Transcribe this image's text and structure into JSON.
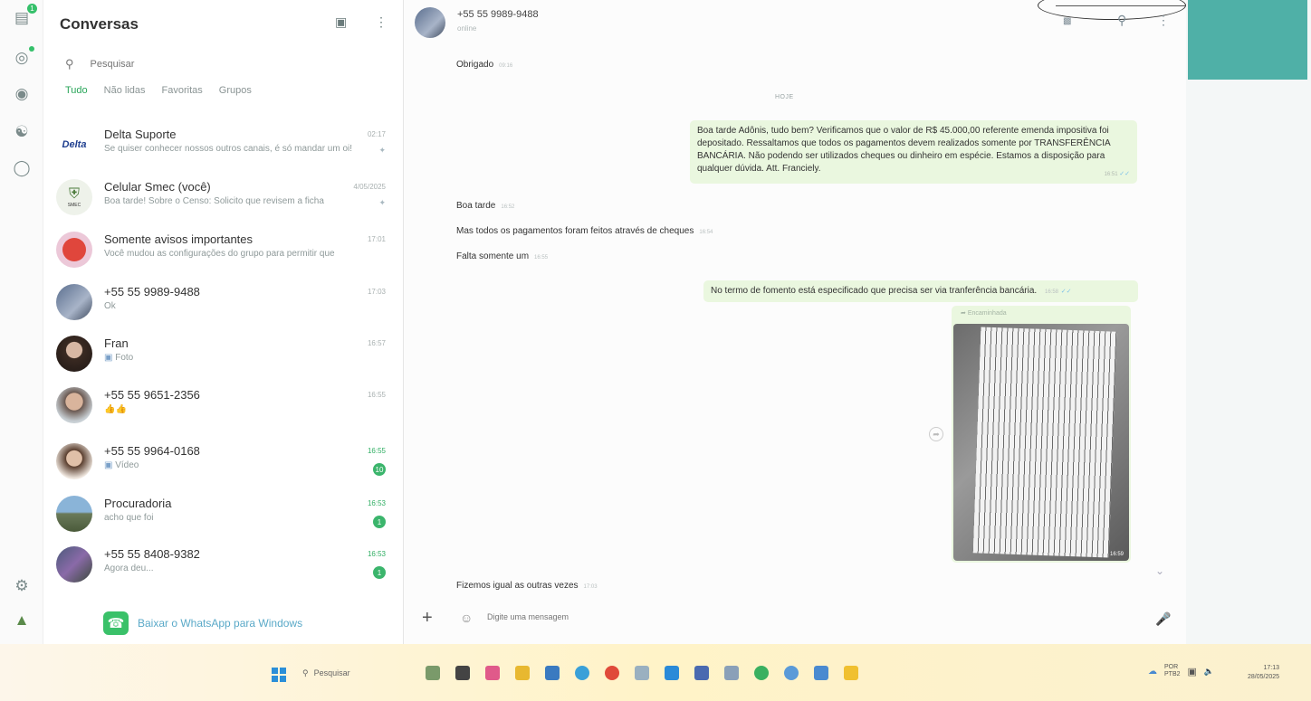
{
  "rail": {
    "chats_badge": "1"
  },
  "list": {
    "title": "Conversas",
    "search_placeholder": "Pesquisar",
    "filters": [
      "Tudo",
      "Não lidas",
      "Favoritas",
      "Grupos"
    ],
    "chats": [
      {
        "name": "Delta Suporte",
        "preview": "Se quiser conhecer nossos outros canais, é só mandar um oi!",
        "time": "02:17",
        "avatar_text": "Delta"
      },
      {
        "name": "Celular Smec (você)",
        "preview": "Boa tarde! Sobre o Censo: Solicito que revisem a ficha",
        "time": "4/05/2025",
        "avatar_text": "SMEC"
      },
      {
        "name": "Somente avisos importantes",
        "preview": "Você mudou as configurações do grupo para permitir que",
        "time": "17:01"
      },
      {
        "name": "+55 55 9989-9488",
        "preview": "Ok",
        "time": "17:03"
      },
      {
        "name": "Fran",
        "preview": "Foto",
        "time": "16:57"
      },
      {
        "name": "+55 55 9651-2356",
        "preview": "👍👍",
        "time": "16:55"
      },
      {
        "name": "+55 55 9964-0168",
        "preview": "Vídeo",
        "time": "16:55",
        "unread": "10"
      },
      {
        "name": "Procuradoria",
        "preview": "acho que foi",
        "time": "16:53",
        "unread": "1"
      },
      {
        "name": "+55 55 8408-9382",
        "preview": "Agora deu...",
        "time": "16:53",
        "unread": "1"
      }
    ],
    "get_app": "Baixar o WhatsApp para Windows"
  },
  "chat": {
    "contact": "+55 55 9989-9488",
    "status": "online",
    "day_separator": "HOJE",
    "messages": [
      {
        "dir": "in",
        "text": "Obrigado",
        "time": "09:16"
      },
      {
        "dir": "out",
        "text": "Boa tarde Adônis, tudo bem? Verificamos que o valor de R$ 45.000,00 referente emenda impositiva foi depositado. Ressaltamos que todos os pagamentos devem realizados somente por TRANSFERÊNCIA BANCÁRIA. Não podendo ser utilizados cheques ou dinheiro em espécie. Estamos a disposição para qualquer dúvida. Att. Franciely.",
        "time": "16:51"
      },
      {
        "dir": "in",
        "text": "Boa tarde",
        "time": "16:52"
      },
      {
        "dir": "in",
        "text": "Mas todos os pagamentos foram feitos através de cheques",
        "time": "16:54"
      },
      {
        "dir": "in",
        "text": "Falta somente um",
        "time": "16:55"
      },
      {
        "dir": "out",
        "text": "No termo de fomento está especificado que precisa ser via tranferência bancária.",
        "time": "16:58"
      },
      {
        "dir": "in",
        "text": "Fizemos igual as outras vezes",
        "time": "17:03"
      }
    ],
    "forwarded_label": "Encaminhada",
    "photo_time": "16:59",
    "composer_placeholder": "Digite uma mensagem"
  },
  "taskbar": {
    "search": "Pesquisar",
    "lang_1": "POR",
    "lang_2": "PTB2",
    "time": "17:13",
    "date": "28/05/2025"
  }
}
